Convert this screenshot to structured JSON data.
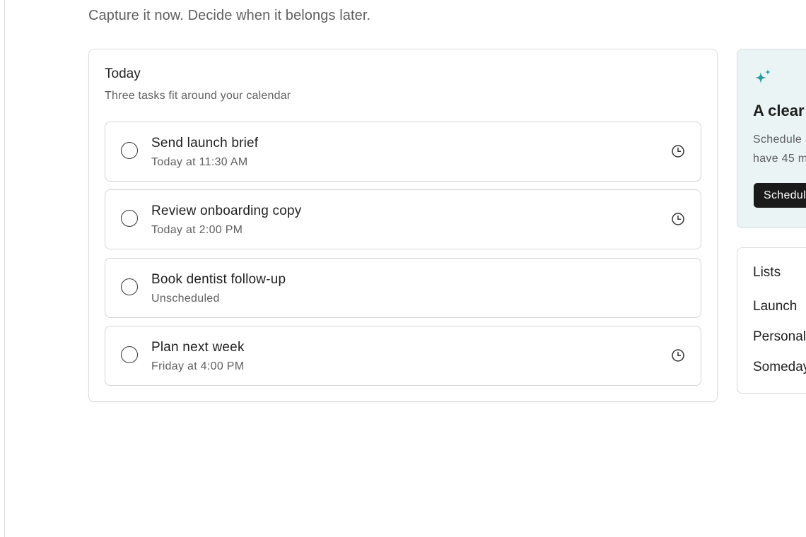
{
  "header": {
    "subtitle": "Capture it now. Decide when it belongs later."
  },
  "today": {
    "title": "Today",
    "subtitle": "Three tasks fit around your calendar",
    "tasks": [
      {
        "title": "Send launch brief",
        "when": "Today at 11:30 AM",
        "has_reminder": true
      },
      {
        "title": "Review onboarding copy",
        "when": "Today at 2:00 PM",
        "has_reminder": true
      },
      {
        "title": "Book dentist follow-up",
        "when": "Unscheduled",
        "has_reminder": false
      },
      {
        "title": "Plan next week",
        "when": "Friday at 4:00 PM",
        "has_reminder": true
      }
    ]
  },
  "suggestion": {
    "icon": "sparkles-icon",
    "headline": "A clear",
    "body": "Schedule\nhave 45 m",
    "button_label": "Schedul",
    "accent_color": "#2a9aa0"
  },
  "lists": {
    "title": "Lists",
    "items": [
      "Launch",
      "Personal",
      "Someday"
    ]
  },
  "colors": {
    "card_border": "#dcdcdc",
    "muted_text": "#5f5f5f",
    "suggestion_bg": "#eaf4f4",
    "button_bg": "#1a1a1a"
  }
}
